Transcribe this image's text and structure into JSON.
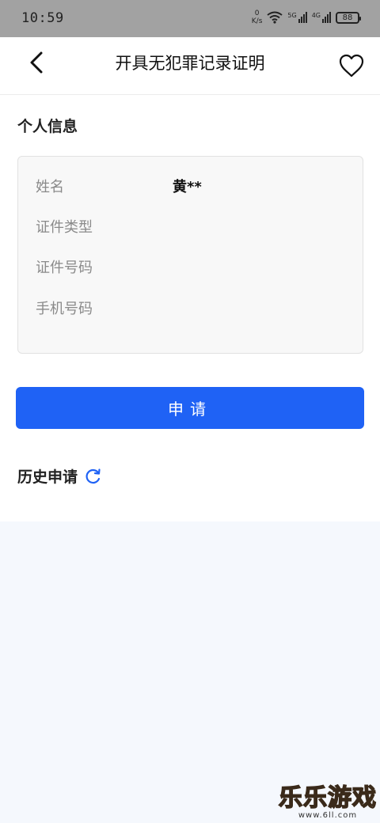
{
  "status_bar": {
    "time": "10:59",
    "net_speed_value": "0",
    "net_speed_unit": "K/s",
    "sim1_label": "5G",
    "sim2_label": "4G",
    "battery": "88"
  },
  "nav": {
    "title": "开具无犯罪记录证明"
  },
  "personal": {
    "section_title": "个人信息",
    "fields": [
      {
        "label": "姓名",
        "value": "黄**"
      },
      {
        "label": "证件类型",
        "value": ""
      },
      {
        "label": "证件号码",
        "value": ""
      },
      {
        "label": "手机号码",
        "value": ""
      }
    ]
  },
  "apply_button_label": "申请",
  "history": {
    "title": "历史申请"
  },
  "watermark": {
    "title": "乐乐游戏",
    "url": "www.6ll.com"
  },
  "colors": {
    "accent": "#1f62f5",
    "status_bar_bg": "#a2a2a2",
    "history_bg": "#f5f8fd"
  }
}
